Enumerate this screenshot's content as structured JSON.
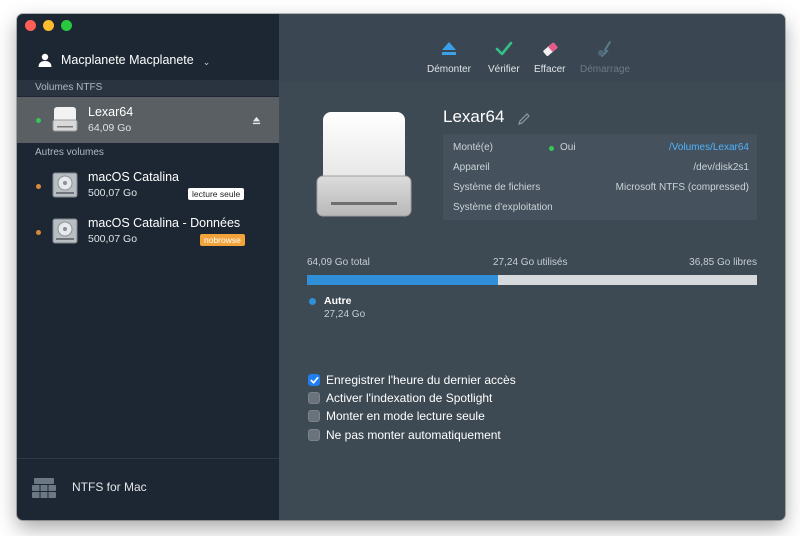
{
  "sidebar": {
    "user": {
      "name": "Macplanete Macplanete",
      "chevron": "⌄"
    },
    "ntfs_section_label": "Volumes NTFS",
    "other_section_label": "Autres volumes",
    "ntfs_volumes": [
      {
        "name": "Lexar64",
        "size": "64,09 Go",
        "status_color": "#35c759"
      }
    ],
    "other_volumes": [
      {
        "name": "macOS Catalina",
        "size": "500,07 Go",
        "badge": "lecture seule",
        "status_color": "#d88a38"
      },
      {
        "name": "macOS Catalina - Données",
        "size": "500,07 Go",
        "badge": "nobrowse",
        "status_color": "#d88a38"
      }
    ],
    "footer": {
      "app_name": "NTFS for Mac",
      "icon": "ntfs-logo-icon"
    }
  },
  "toolbar": {
    "buttons": [
      {
        "label": "Démonter",
        "icon": "eject-icon",
        "enabled": true
      },
      {
        "label": "Vérifier",
        "icon": "checkmark-icon",
        "enabled": true
      },
      {
        "label": "Effacer",
        "icon": "eraser-icon",
        "enabled": true
      },
      {
        "label": "Démarrage",
        "icon": "startup-icon",
        "enabled": false
      }
    ]
  },
  "volume": {
    "name": "Lexar64",
    "info": {
      "mounted_label": "Monté(e)",
      "mounted_value": "Oui",
      "mount_path": "/Volumes/Lexar64",
      "device_label": "Appareil",
      "device_value": "/dev/disk2s1",
      "fs_label": "Système de fichiers",
      "fs_value": "Microsoft NTFS (compressed)",
      "os_label": "Système d'exploitation",
      "os_value": ""
    },
    "usage": {
      "total": "64,09 Go total",
      "used": "27,24 Go utilisés",
      "free": "36,85 Go libres",
      "used_fraction": 0.425,
      "legend_name": "Autre",
      "legend_value": "27,24 Go",
      "color": "#2f8fd9"
    }
  },
  "options": [
    {
      "label": "Enregistrer l'heure du dernier accès",
      "checked": true
    },
    {
      "label": "Activer l'indexation de Spotlight",
      "checked": false
    },
    {
      "label": "Monter en mode lecture seule",
      "checked": false
    },
    {
      "label": "Ne pas monter automatiquement",
      "checked": false
    }
  ]
}
